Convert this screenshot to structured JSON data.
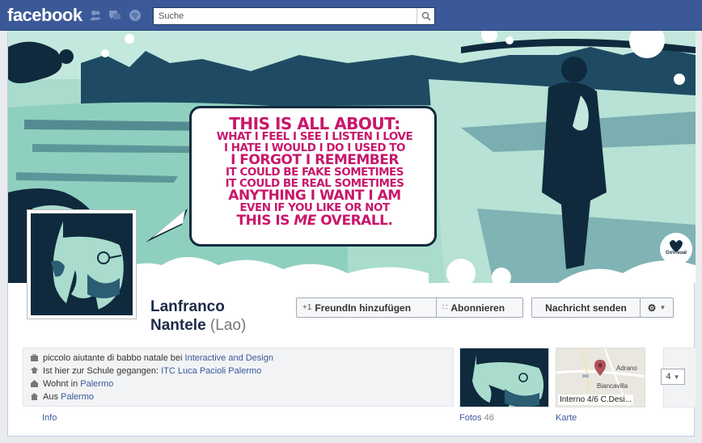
{
  "topbar": {
    "logo": "facebook",
    "search_placeholder": "Suche",
    "icons": [
      "friend-requests-icon",
      "messages-icon",
      "notifications-icon",
      "search-icon"
    ]
  },
  "cover": {
    "quote_lines": [
      "THIS IS ALL ABOUT:",
      "WHAT I FEEL I SEE I LISTEN I LOVE",
      "I HATE I WOULD I DO I USED TO",
      "I FORGOT I REMEMBER",
      "IT COULD BE FAKE SOMETIMES",
      "IT COULD BE REAL SOMETIMES",
      "ANYTHING I WANT I AM",
      "EVEN IF YOU LIKE OR NOT",
      "THIS IS ",
      "ME",
      " OVERALL."
    ],
    "badge_text": "GoVisual"
  },
  "profile": {
    "first_name": "Lanfranco",
    "last_name": "Nantele",
    "alt_name": "(Lao)"
  },
  "actions": {
    "add_friend": "FreundIn hinzufügen",
    "subscribe": "Abonnieren",
    "message": "Nachricht senden"
  },
  "info": {
    "work_prefix": "piccolo aiutante di babbo natale bei ",
    "work_link": "Interactive and Design",
    "school_prefix": "Ist hier zur Schule gegangen: ",
    "school_link": "ITC Luca Pacioli Palermo",
    "lives_prefix": "Wohnt in ",
    "lives_link": "Palermo",
    "from_prefix": "Aus ",
    "from_link": "Palermo"
  },
  "sections": {
    "info_label": "Info",
    "photos_label": "Fotos",
    "photos_count": "46",
    "map_label": "Karte",
    "map_place": "Interno 4/6 C.Desi...",
    "map_town_1": "Adrano",
    "map_town_2": "Biancavilla",
    "more_count": "4"
  },
  "colors": {
    "brand_blue": "#3b5998",
    "quote_magenta": "#c8176b",
    "cover_teal": "#a8d8c8",
    "cover_navy": "#0f2a3d"
  }
}
